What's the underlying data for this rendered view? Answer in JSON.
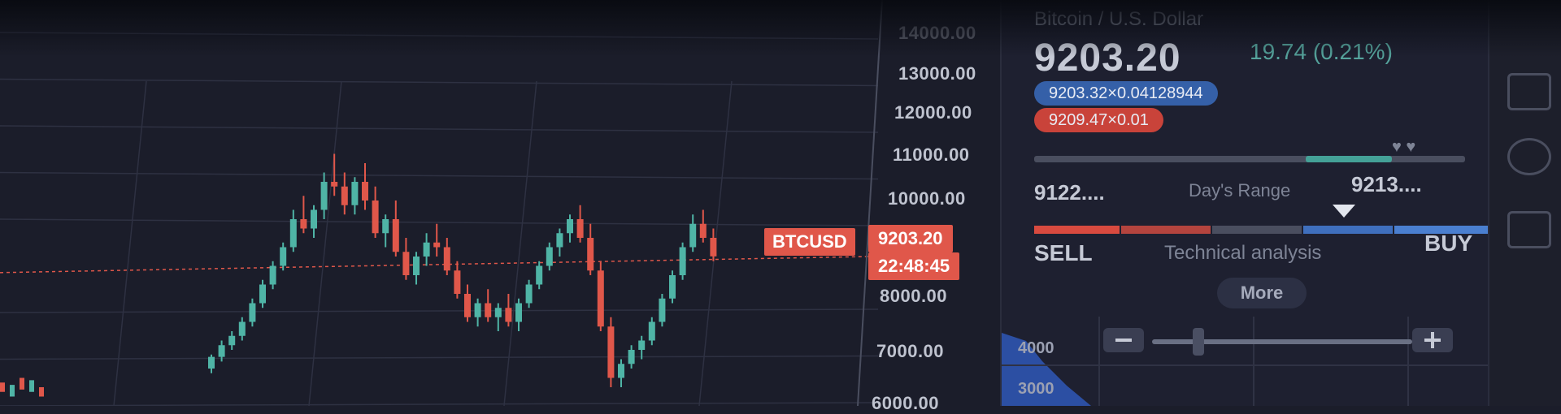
{
  "instrument": {
    "symbol": "BTCUSD",
    "name": "Bitcoin / U.S. Dollar",
    "last_price": "9203.20",
    "change": "19.74 (0.21%)",
    "countdown": "22:48:45",
    "bid_pill": "9203.32×0.04128944",
    "ask_pill": "9209.47×0.01"
  },
  "price_axis": [
    "14000.00",
    "13000.00",
    "12000.00",
    "11000.00",
    "10000.00",
    "8000.00",
    "7000.00",
    "6000.00"
  ],
  "days_range": {
    "low": "9122....",
    "label": "Day's Range",
    "high": "9213....",
    "fill_fraction_start": 0.63,
    "fill_fraction_end": 0.83
  },
  "technical_analysis": {
    "sell_label": "SELL",
    "label": "Technical analysis",
    "buy_label": "BUY",
    "pointer_fraction": 0.68
  },
  "more_button": "More",
  "mini_chart": {
    "labels": [
      "4000",
      "3000"
    ]
  },
  "colors": {
    "up": "#4fb4a6",
    "down": "#e0574a",
    "background": "#1b1d2a",
    "panel": "#1e2030",
    "bid": "#3560a8",
    "ask": "#c9433a",
    "accent_teal": "#44a197"
  },
  "chart_data": {
    "type": "candlestick",
    "series": [
      {
        "values": [
          [
            6800,
            7100,
            6700,
            7050
          ],
          [
            7050,
            7400,
            6950,
            7300
          ],
          [
            7300,
            7600,
            7200,
            7500
          ],
          [
            7500,
            7900,
            7400,
            7800
          ],
          [
            7800,
            8300,
            7700,
            8200
          ],
          [
            8200,
            8700,
            8100,
            8600
          ],
          [
            8600,
            9100,
            8500,
            9000
          ],
          [
            9000,
            9500,
            8900,
            9400
          ],
          [
            9400,
            10200,
            9300,
            10000
          ],
          [
            10000,
            10500,
            9700,
            9800
          ],
          [
            9800,
            10300,
            9600,
            10200
          ],
          [
            10200,
            11000,
            10000,
            10800
          ],
          [
            10800,
            11400,
            10500,
            10700
          ],
          [
            10700,
            11000,
            10100,
            10300
          ],
          [
            10300,
            10900,
            10100,
            10800
          ],
          [
            10800,
            11200,
            10200,
            10400
          ],
          [
            10400,
            10700,
            9600,
            9700
          ],
          [
            9700,
            10100,
            9400,
            10000
          ],
          [
            10000,
            10400,
            9200,
            9300
          ],
          [
            9300,
            9600,
            8700,
            8800
          ],
          [
            8800,
            9300,
            8600,
            9200
          ],
          [
            9200,
            9700,
            9000,
            9500
          ],
          [
            9500,
            9900,
            9200,
            9400
          ],
          [
            9400,
            9600,
            8800,
            8900
          ],
          [
            8900,
            9100,
            8300,
            8400
          ],
          [
            8400,
            8600,
            7800,
            7900
          ],
          [
            7900,
            8300,
            7700,
            8200
          ],
          [
            8200,
            8500,
            7800,
            7900
          ],
          [
            7900,
            8200,
            7600,
            8100
          ],
          [
            8100,
            8400,
            7700,
            7800
          ],
          [
            7800,
            8300,
            7600,
            8200
          ],
          [
            8200,
            8700,
            8100,
            8600
          ],
          [
            8600,
            9100,
            8500,
            9000
          ],
          [
            9000,
            9500,
            8900,
            9400
          ],
          [
            9400,
            9800,
            9200,
            9700
          ],
          [
            9700,
            10100,
            9500,
            10000
          ],
          [
            10000,
            10300,
            9500,
            9600
          ],
          [
            9600,
            9900,
            8800,
            8900
          ],
          [
            8900,
            9100,
            7600,
            7700
          ],
          [
            7700,
            7900,
            6400,
            6600
          ],
          [
            6600,
            7000,
            6400,
            6900
          ],
          [
            6900,
            7300,
            6800,
            7200
          ],
          [
            7200,
            7500,
            7000,
            7400
          ],
          [
            7400,
            7900,
            7300,
            7800
          ],
          [
            7800,
            8400,
            7700,
            8300
          ],
          [
            8300,
            8900,
            8200,
            8800
          ],
          [
            8800,
            9500,
            8700,
            9400
          ],
          [
            9400,
            10100,
            9300,
            9900
          ],
          [
            9900,
            10200,
            9500,
            9600
          ],
          [
            9600,
            9800,
            9100,
            9203
          ]
        ]
      }
    ],
    "ylim": [
      6000,
      14000
    ],
    "grid": true,
    "current_price_line": 9203.2
  }
}
